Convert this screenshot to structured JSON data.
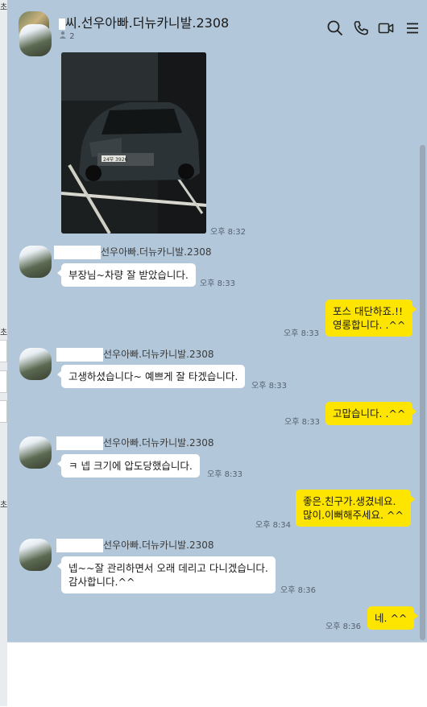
{
  "header": {
    "title": "씨.선우아빠.더뉴카니발.2308",
    "member_count": "2",
    "icons": [
      "search-icon",
      "phone-icon",
      "video-icon",
      "menu-icon"
    ]
  },
  "side_strip": {
    "chars": [
      "초",
      "초",
      "초"
    ]
  },
  "messages": [
    {
      "type": "photo",
      "time": "오후 8:32",
      "plate": "24부 3926"
    },
    {
      "type": "in",
      "sender": "선우아빠.더뉴카니발.2308",
      "text": "부장님~차량 잘 받았습니다.",
      "time": "오후 8:33"
    },
    {
      "type": "out",
      "lines": [
        "포스 대단하죠.!!",
        "영롱합니다. .^^"
      ],
      "time": "오후 8:33"
    },
    {
      "type": "in",
      "sender": "선우아빠.더뉴카니발.2308",
      "text": "고생하셨습니다~ 예쁘게 잘 타겠습니다.",
      "time": "오후 8:33"
    },
    {
      "type": "out",
      "lines": [
        "고맙습니다. .^^"
      ],
      "time": "오후 8:33"
    },
    {
      "type": "in",
      "sender": "선우아빠.더뉴카니발.2308",
      "text": "ㅋ 넵 크기에 압도당했습니다.",
      "time": "오후 8:33"
    },
    {
      "type": "out",
      "lines": [
        "좋은.친구가.생겼네요.",
        "많이.이뻐해주세요. ^^"
      ],
      "time": "오후 8:34"
    },
    {
      "type": "in",
      "sender": "선우아빠.더뉴카니발.2308",
      "lines": [
        "넵~~잘 관리하면서 오래 데리고 다니겠습니다.",
        "감사합니다.^^"
      ],
      "time": "오후 8:36"
    },
    {
      "type": "out",
      "lines": [
        "네. ^^"
      ],
      "time": "오후 8:36"
    }
  ],
  "colors": {
    "chat_bg": "#b2c7da",
    "out_bubble": "#fee500",
    "in_bubble": "#ffffff"
  }
}
